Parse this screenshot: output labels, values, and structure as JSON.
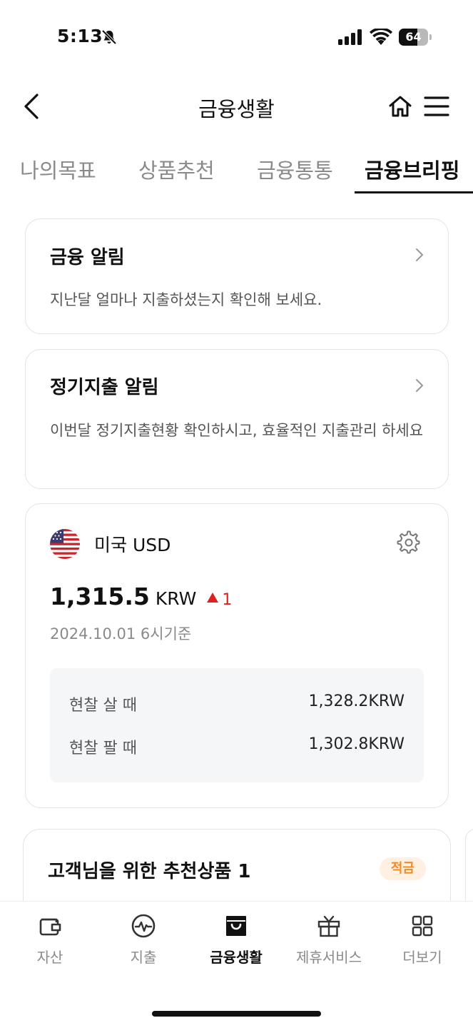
{
  "status_bar": {
    "time": "5:13",
    "battery_level": "64",
    "battery_fraction": 0.64
  },
  "header": {
    "title": "금융생활"
  },
  "tabs": [
    {
      "label": "나의목표",
      "active": false
    },
    {
      "label": "상품추천",
      "active": false
    },
    {
      "label": "금융통통",
      "active": false
    },
    {
      "label": "금융브리핑",
      "active": true
    }
  ],
  "cards": {
    "finance_alert": {
      "title": "금융 알림",
      "desc": "지난달 얼마나 지출하셨는지 확인해 보세요."
    },
    "recurring_alert": {
      "title": "정기지출 알림",
      "desc": "이번달 정기지출현황 확인하시고, 효율적인 지출관리 하세요"
    }
  },
  "exchange": {
    "country": "미국 USD",
    "flag_icon": "us-flag-icon",
    "rate": "1,315.5",
    "unit": "KRW",
    "change": "1",
    "change_direction": "up",
    "date": "2024.10.01 6시기준",
    "cash_buy_label": "현찰 살 때",
    "cash_buy_value": "1,328.2KRW",
    "cash_sell_label": "현찰 팔 때",
    "cash_sell_value": "1,302.8KRW"
  },
  "recommendation": {
    "title": "고객님을 위한 추천상품 1",
    "badge": "적금"
  },
  "bottom_nav": [
    {
      "label": "자산",
      "icon": "wallet-icon",
      "active": false
    },
    {
      "label": "지출",
      "icon": "pulse-icon",
      "active": false
    },
    {
      "label": "금융생활",
      "icon": "shopping-bag-icon",
      "active": true
    },
    {
      "label": "제휴서비스",
      "icon": "gift-icon",
      "active": false
    },
    {
      "label": "더보기",
      "icon": "grid-icon",
      "active": false
    }
  ],
  "colors": {
    "accent_red": "#e02020",
    "badge_bg": "#fff0e2",
    "badge_text": "#f08a24",
    "inactive_text": "#8a8a8a"
  }
}
